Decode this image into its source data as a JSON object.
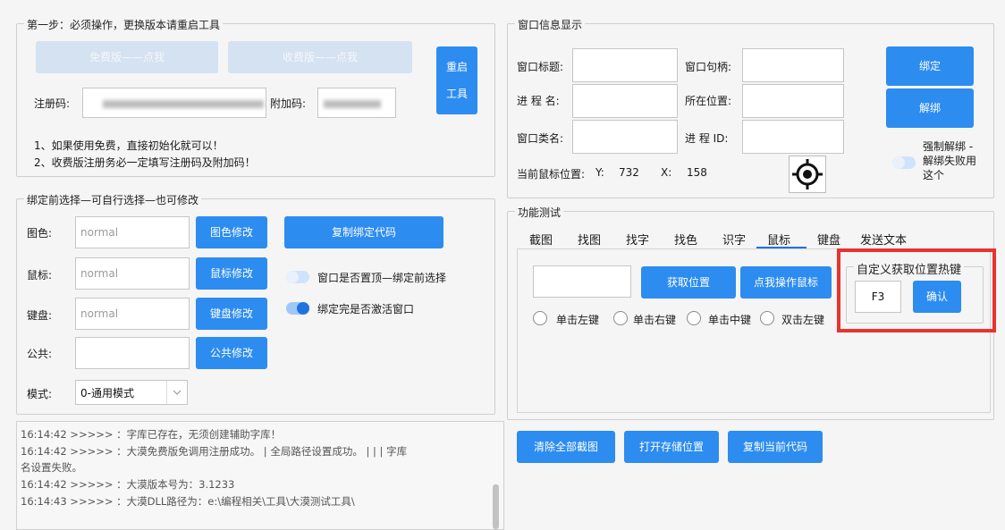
{
  "step1": {
    "title": "第一步：必须操作，更换版本请重启工具",
    "free_btn": "免费版——点我",
    "paid_btn": "收费版——点我",
    "restart_btn_line1": "重启",
    "restart_btn_line2": "工具",
    "reg_label": "注册码:",
    "reg_value": "",
    "addon_label": "附加码:",
    "addon_value": "",
    "note1": "1、如果使用免费，直接初始化就可以！",
    "note2": "2、收费版注册务必一定填写注册码及附加码！"
  },
  "window_info": {
    "title": "窗口信息显示",
    "win_title_label": "窗口标题:",
    "win_handle_label": "窗口句柄:",
    "proc_name_label": "进 程 名:",
    "location_label": "所在位置:",
    "class_label": "窗口类名:",
    "pid_label": "进 程 ID:",
    "mouse_pos_label": "当前鼠标位置:",
    "y_label": "Y:",
    "y_value": "732",
    "x_label": "X:",
    "x_value": "158",
    "bind_btn": "绑定",
    "unbind_btn": "解绑",
    "force_unbind_line1": "强制解绑 -",
    "force_unbind_line2": "解绑失败用",
    "force_unbind_line3": "这个"
  },
  "binding": {
    "title": "绑定前选择—可自行选择—也可修改",
    "color_label": "图色:",
    "color_value": "normal",
    "color_btn": "图色修改",
    "copy_code_btn": "复制绑定代码",
    "mouse_label": "鼠标:",
    "mouse_value": "normal",
    "mouse_btn": "鼠标修改",
    "topmost_toggle_label": "窗口是否置顶—绑定前选择",
    "keyboard_label": "键盘:",
    "keyboard_value": "normal",
    "keyboard_btn": "键盘修改",
    "activate_toggle_label": "绑定完是否激活窗口",
    "public_label": "公共:",
    "public_value": "",
    "public_btn": "公共修改",
    "mode_label": "模式:",
    "mode_value": "0-通用模式"
  },
  "log": {
    "lines": [
      "16:14:42 >>>>>  ：字库已存在，无须创建辅助字库！",
      "16:14:42 >>>>>  ：大漠免费版免调用注册成功。 | 全局路径设置成功。 | | | 字库",
      "名设置失败。",
      "16:14:42 >>>>>  ：大漠版本号为：3.1233",
      "16:14:43 >>>>>  ：大漠DLL路径为：e:\\编程相关\\工具\\大漠测试工具\\"
    ]
  },
  "func_test": {
    "title": "功能测试",
    "tabs": [
      "截图",
      "找图",
      "找字",
      "找色",
      "识字",
      "鼠标",
      "键盘",
      "发送文本"
    ],
    "active_tab": "鼠标",
    "get_pos_btn": "获取位置",
    "click_mouse_btn": "点我操作鼠标",
    "radios": [
      "单击左键",
      "单击右键",
      "单击中键",
      "双击左键"
    ],
    "hotkey_group_title": "自定义获取位置热键",
    "hotkey_value": "F3",
    "confirm_btn": "确认",
    "pos_value": "",
    "highlight_color": "#e8332f"
  },
  "bottom_buttons": {
    "clear_btn": "清除全部截图",
    "open_storage_btn": "打开存储位置",
    "copy_current_btn": "复制当前代码"
  },
  "colors": {
    "accent": "#2d8cf0",
    "disabled": "#d4e2f1"
  }
}
